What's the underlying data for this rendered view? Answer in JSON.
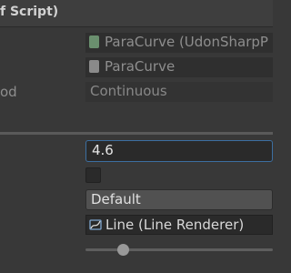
{
  "header": {
    "title": "f Script)"
  },
  "script_field": {
    "value": "ParaCurve (UdonSharpP"
  },
  "program_field": {
    "value": "ParaCurve"
  },
  "sync_method": {
    "label": "od",
    "value": "Continuous"
  },
  "properties": {
    "number_input": "4.6",
    "checkbox_checked": false,
    "dropdown_value": "Default",
    "line_renderer_value": "Line (Line Renderer)",
    "slider_fraction": 0.2
  },
  "icons": {
    "script": "script-asset-icon",
    "program": "program-asset-icon",
    "line": "line-renderer-icon"
  }
}
